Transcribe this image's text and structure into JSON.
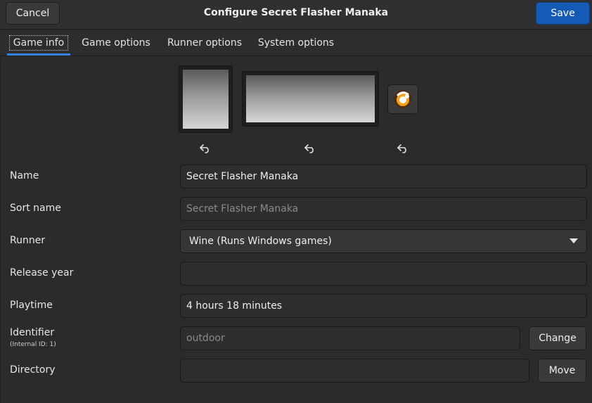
{
  "window": {
    "title": "Configure Secret Flasher Manaka",
    "cancel_label": "Cancel",
    "save_label": "Save",
    "accent_color": "#155bb5"
  },
  "tabs": [
    {
      "label": "Game info",
      "active": true
    },
    {
      "label": "Game options",
      "active": false
    },
    {
      "label": "Runner options",
      "active": false
    },
    {
      "label": "System options",
      "active": false
    }
  ],
  "media": {
    "cover_icon": "image-placeholder",
    "banner_icon": "image-placeholder",
    "game_icon": "lutris-icon",
    "reset_icon": "undo-arrow-icon"
  },
  "form": {
    "name": {
      "label": "Name",
      "value": "Secret Flasher Manaka"
    },
    "sort_name": {
      "label": "Sort name",
      "value": "",
      "placeholder": "Secret Flasher Manaka"
    },
    "runner": {
      "label": "Runner",
      "value": "Wine (Runs Windows games)"
    },
    "release_year": {
      "label": "Release year",
      "value": ""
    },
    "playtime": {
      "label": "Playtime",
      "value": "4 hours 18 minutes"
    },
    "identifier": {
      "label": "Identifier",
      "sublabel": "(Internal ID: 1)",
      "value": "",
      "placeholder": "outdoor",
      "button_label": "Change"
    },
    "directory": {
      "label": "Directory",
      "value": "",
      "button_label": "Move"
    }
  }
}
